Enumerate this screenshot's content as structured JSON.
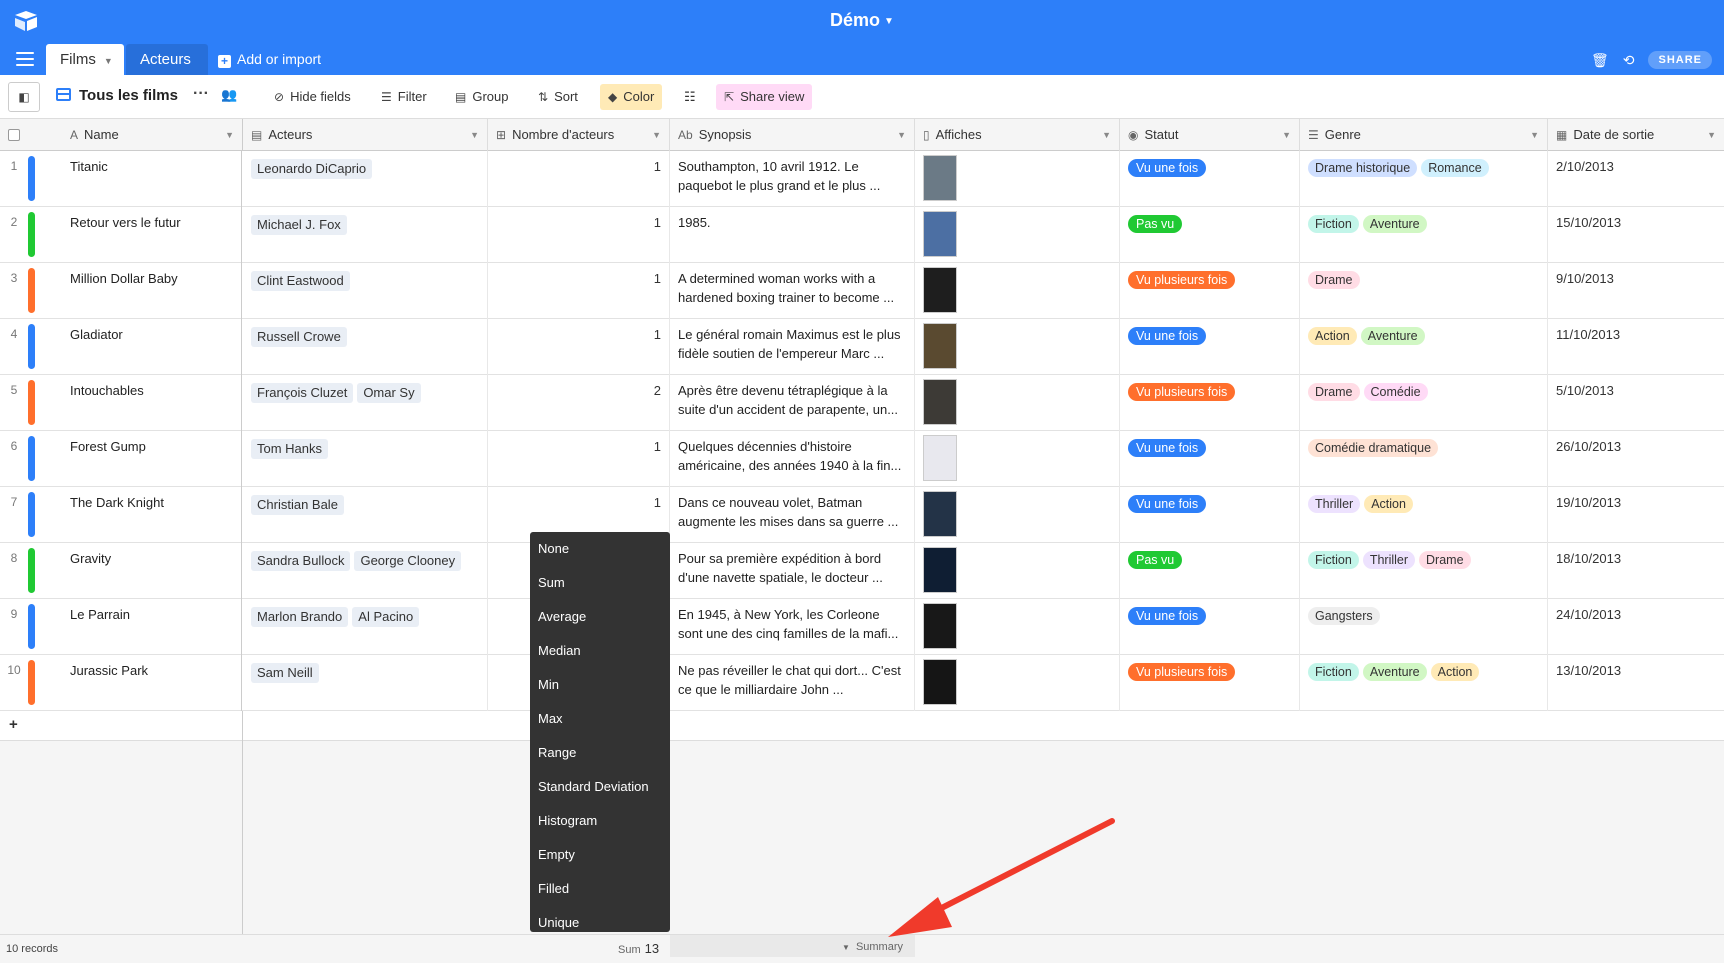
{
  "app": {
    "base_title": "Démo",
    "tabs": [
      "Films",
      "Acteurs"
    ],
    "add_import": "Add or import",
    "share": "SHARE"
  },
  "toolbar": {
    "view_name": "Tous les films",
    "hide_fields": "Hide fields",
    "filter": "Filter",
    "group": "Group",
    "sort": "Sort",
    "color": "Color",
    "share_view": "Share view"
  },
  "columns": [
    "Name",
    "Acteurs",
    "Nombre d'acteurs",
    "Synopsis",
    "Affiches",
    "Statut",
    "Genre",
    "Date de sortie"
  ],
  "colors": {
    "header_bg": "#2d7ff9",
    "bar_blue": "#2d7ff9",
    "bar_green": "#20c933",
    "bar_orange": "#ff6f2c",
    "status_vu_une_fois": "#2d7ff9",
    "status_pas_vu": "#20c933",
    "status_vu_plusieurs": "#ff6f2c"
  },
  "rows": [
    {
      "n": "1",
      "bar": "blue",
      "name": "Titanic",
      "actors": [
        "Leonardo DiCaprio"
      ],
      "count": "1",
      "synopsis": "Southampton, 10 avril 1912. Le paquebot le plus grand et le plus ...",
      "poster": "#6b7a86",
      "status": "Vu une fois",
      "status_color": "blue",
      "genres": [
        {
          "label": "Drame historique",
          "color": "#cfdfff"
        },
        {
          "label": "Romance",
          "color": "#d0f0fd"
        }
      ],
      "date": "2/10/2013"
    },
    {
      "n": "2",
      "bar": "green",
      "name": "Retour vers le futur",
      "actors": [
        "Michael J. Fox"
      ],
      "count": "1",
      "synopsis": " 1985.",
      "poster": "#4c6fa3",
      "status": "Pas vu",
      "status_color": "green",
      "genres": [
        {
          "label": "Fiction",
          "color": "#c2f5e9"
        },
        {
          "label": "Aventure",
          "color": "#d1f7c4"
        }
      ],
      "date": "15/10/2013"
    },
    {
      "n": "3",
      "bar": "orange",
      "name": "Million Dollar Baby",
      "actors": [
        "Clint Eastwood"
      ],
      "count": "1",
      "synopsis": "A determined woman works with a hardened boxing trainer to become ...",
      "poster": "#1e1e1e",
      "status": "Vu plusieurs fois",
      "status_color": "orange",
      "genres": [
        {
          "label": "Drame",
          "color": "#ffdce5"
        }
      ],
      "date": "9/10/2013"
    },
    {
      "n": "4",
      "bar": "blue",
      "name": "Gladiator",
      "actors": [
        "Russell Crowe"
      ],
      "count": "1",
      "synopsis": "Le général romain Maximus est le plus fidèle soutien de l'empereur Marc ...",
      "poster": "#5a4a30",
      "status": "Vu une fois",
      "status_color": "blue",
      "genres": [
        {
          "label": "Action",
          "color": "#ffeab6"
        },
        {
          "label": "Aventure",
          "color": "#d1f7c4"
        }
      ],
      "date": "11/10/2013"
    },
    {
      "n": "5",
      "bar": "orange",
      "name": "Intouchables",
      "actors": [
        "François Cluzet",
        "Omar Sy"
      ],
      "count": "2",
      "synopsis": "Après être devenu tétraplégique à la suite d'un accident de parapente, un...",
      "poster": "#3d3a36",
      "status": "Vu plusieurs fois",
      "status_color": "orange",
      "genres": [
        {
          "label": "Drame",
          "color": "#ffdce5"
        },
        {
          "label": "Comédie",
          "color": "#ffdaf6"
        }
      ],
      "date": "5/10/2013"
    },
    {
      "n": "6",
      "bar": "blue",
      "name": "Forest Gump",
      "actors": [
        "Tom Hanks"
      ],
      "count": "1",
      "synopsis": "Quelques décennies d'histoire américaine, des années 1940 à la fin...",
      "poster": "#e8e8ee",
      "status": "Vu une fois",
      "status_color": "blue",
      "genres": [
        {
          "label": "Comédie dramatique",
          "color": "#fee2d5"
        }
      ],
      "date": "26/10/2013"
    },
    {
      "n": "7",
      "bar": "blue",
      "name": "The Dark Knight",
      "actors": [
        "Christian Bale"
      ],
      "count": "1",
      "synopsis": "Dans ce nouveau volet, Batman augmente les mises dans sa guerre ...",
      "poster": "#233347",
      "status": "Vu une fois",
      "status_color": "blue",
      "genres": [
        {
          "label": "Thriller",
          "color": "#ede2fe"
        },
        {
          "label": "Action",
          "color": "#ffeab6"
        }
      ],
      "date": "19/10/2013"
    },
    {
      "n": "8",
      "bar": "green",
      "name": "Gravity",
      "actors": [
        "Sandra Bullock",
        "George Clooney"
      ],
      "count": "",
      "synopsis": "Pour sa première expédition à bord d'une navette spatiale, le docteur ...",
      "poster": "#0f1e33",
      "status": "Pas vu",
      "status_color": "green",
      "genres": [
        {
          "label": "Fiction",
          "color": "#c2f5e9"
        },
        {
          "label": "Thriller",
          "color": "#ede2fe"
        },
        {
          "label": "Drame",
          "color": "#ffdce5"
        }
      ],
      "date": "18/10/2013"
    },
    {
      "n": "9",
      "bar": "blue",
      "name": "Le Parrain",
      "actors": [
        "Marlon Brando",
        "Al Pacino"
      ],
      "count": "",
      "synopsis": "En 1945, à New York, les Corleone sont une des cinq familles de la mafi...",
      "poster": "#181818",
      "status": "Vu une fois",
      "status_color": "blue",
      "genres": [
        {
          "label": "Gangsters",
          "color": "#eeeeee"
        }
      ],
      "date": "24/10/2013"
    },
    {
      "n": "10",
      "bar": "orange",
      "name": "Jurassic Park",
      "actors": [
        "Sam Neill"
      ],
      "count": "",
      "synopsis": "Ne pas réveiller le chat qui dort... C'est ce que le milliardaire John ...",
      "poster": "#151515",
      "status": "Vu plusieurs fois",
      "status_color": "orange",
      "genres": [
        {
          "label": "Fiction",
          "color": "#c2f5e9"
        },
        {
          "label": "Aventure",
          "color": "#d1f7c4"
        },
        {
          "label": "Action",
          "color": "#ffeab6"
        }
      ],
      "date": "13/10/2013"
    }
  ],
  "summary_menu": [
    "None",
    "Sum",
    "Average",
    "Median",
    "Min",
    "Max",
    "Range",
    "Standard Deviation",
    "Histogram",
    "Empty",
    "Filled",
    "Unique"
  ],
  "footer": {
    "records": "10 records",
    "sum_label": "Sum",
    "sum_value": "13",
    "summary": "Summary"
  }
}
